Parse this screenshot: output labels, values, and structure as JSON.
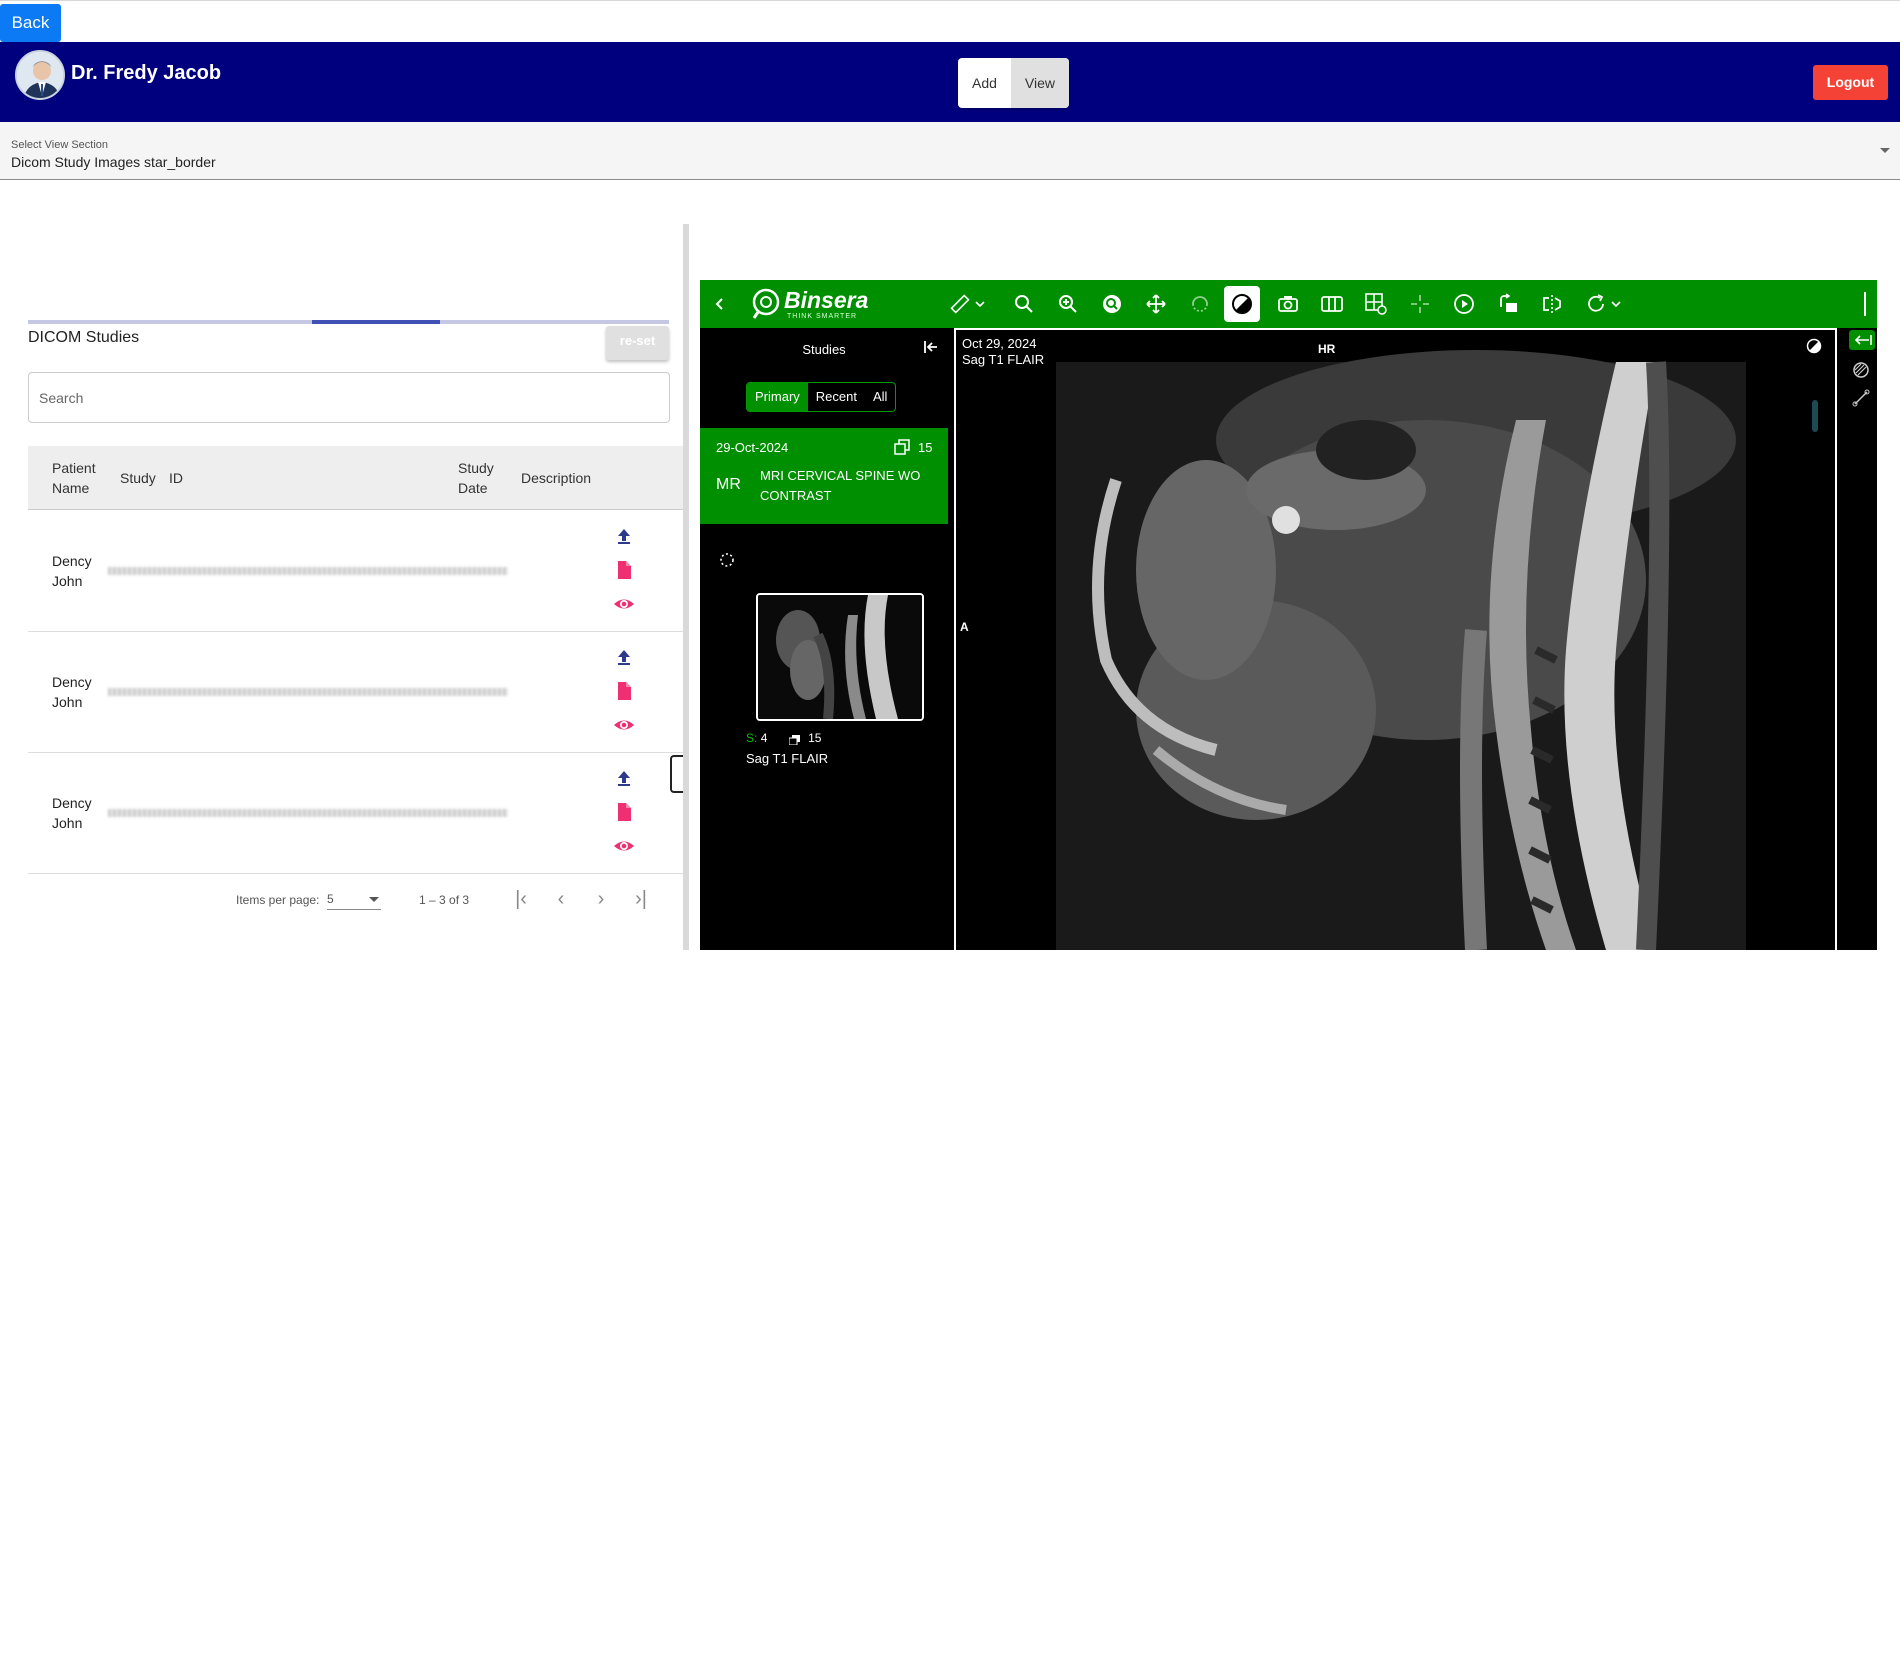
{
  "nav": {
    "back_label": "Back"
  },
  "header": {
    "doctor_name": "Dr. Fredy Jacob",
    "mode_add": "Add",
    "mode_view": "View",
    "logout_label": "Logout",
    "bar_color": "#00007e"
  },
  "view_select": {
    "label": "Select View Section",
    "value": "Dicom Study Images star_border"
  },
  "studies_panel": {
    "title": "DICOM Studies",
    "reset_label": "re-set",
    "search_placeholder": "Search",
    "columns": {
      "patient_name": "Patient Name",
      "study": "Study",
      "id": "ID",
      "study_date": "Study Date",
      "description": "Description"
    },
    "rows": [
      {
        "patient": "Dency John",
        "study_id_redacted": true
      },
      {
        "patient": "Dency John",
        "study_id_redacted": true
      },
      {
        "patient": "Dency John",
        "study_id_redacted": true
      }
    ],
    "row_actions": [
      "upload-icon",
      "file-icon",
      "eye-icon"
    ],
    "paginator": {
      "items_per_page_label": "Items per page:",
      "items_per_page": "5",
      "range": "1 – 3 of 3"
    }
  },
  "viewer": {
    "brand": "Binsera",
    "brand_tagline": "THINK SMARTER",
    "brand_color": "#008f00",
    "toolbar_icons": [
      "back-chevron-icon",
      "ruler-icon",
      "dropdown-chevron-icon",
      "search-icon",
      "zoom-in-icon",
      "magnifier-icon",
      "pan-icon",
      "rotate-3d-icon",
      "contrast-icon",
      "camera-icon",
      "layout-columns-icon",
      "grid-settings-icon",
      "crosshair-icon",
      "play-icon",
      "rotate-icon",
      "flip-icon",
      "refresh-icon",
      "dropdown-chevron-icon"
    ],
    "studies_title": "Studies",
    "filters": [
      "Primary",
      "Recent",
      "All"
    ],
    "active_filter": "Primary",
    "study_card": {
      "date": "29-Oct-2024",
      "count": "15",
      "modality": "MR",
      "description": "MRI CERVICAL SPINE WO CONTRAST"
    },
    "series": {
      "series_prefix": "S:",
      "series_number": "4",
      "image_count": "15",
      "name": "Sag T1 FLAIR"
    },
    "overlay": {
      "date": "Oct 29, 2024",
      "series_name": "Sag T1 FLAIR",
      "orientation_top": "HR",
      "orientation_left": "A"
    }
  }
}
